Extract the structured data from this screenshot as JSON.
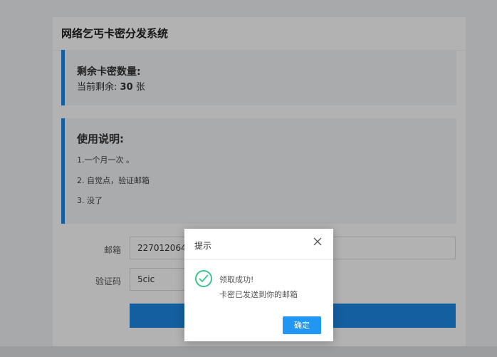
{
  "page": {
    "title": "网络乞丐卡密分发系统"
  },
  "stock_panel": {
    "heading": "剩余卡密数量:",
    "remain_prefix": "当前剩余:",
    "remain_count": "30",
    "remain_unit": "张"
  },
  "instructions": {
    "heading": "使用说明:",
    "items": [
      "1.一个月一次 。",
      "2. 自觉点，验证邮箱",
      "3. 没了"
    ]
  },
  "form": {
    "email_label": "邮箱",
    "email_value": "2270120640",
    "code_label": "验证码",
    "code_value": "5cic",
    "submit_label": ""
  },
  "dialog": {
    "title": "提示",
    "message1": "领取成功!",
    "message2": "卡密已发送到你的邮箱",
    "confirm_label": "确定"
  },
  "colors": {
    "accent": "#1e88e5",
    "success": "#3cc28c"
  }
}
